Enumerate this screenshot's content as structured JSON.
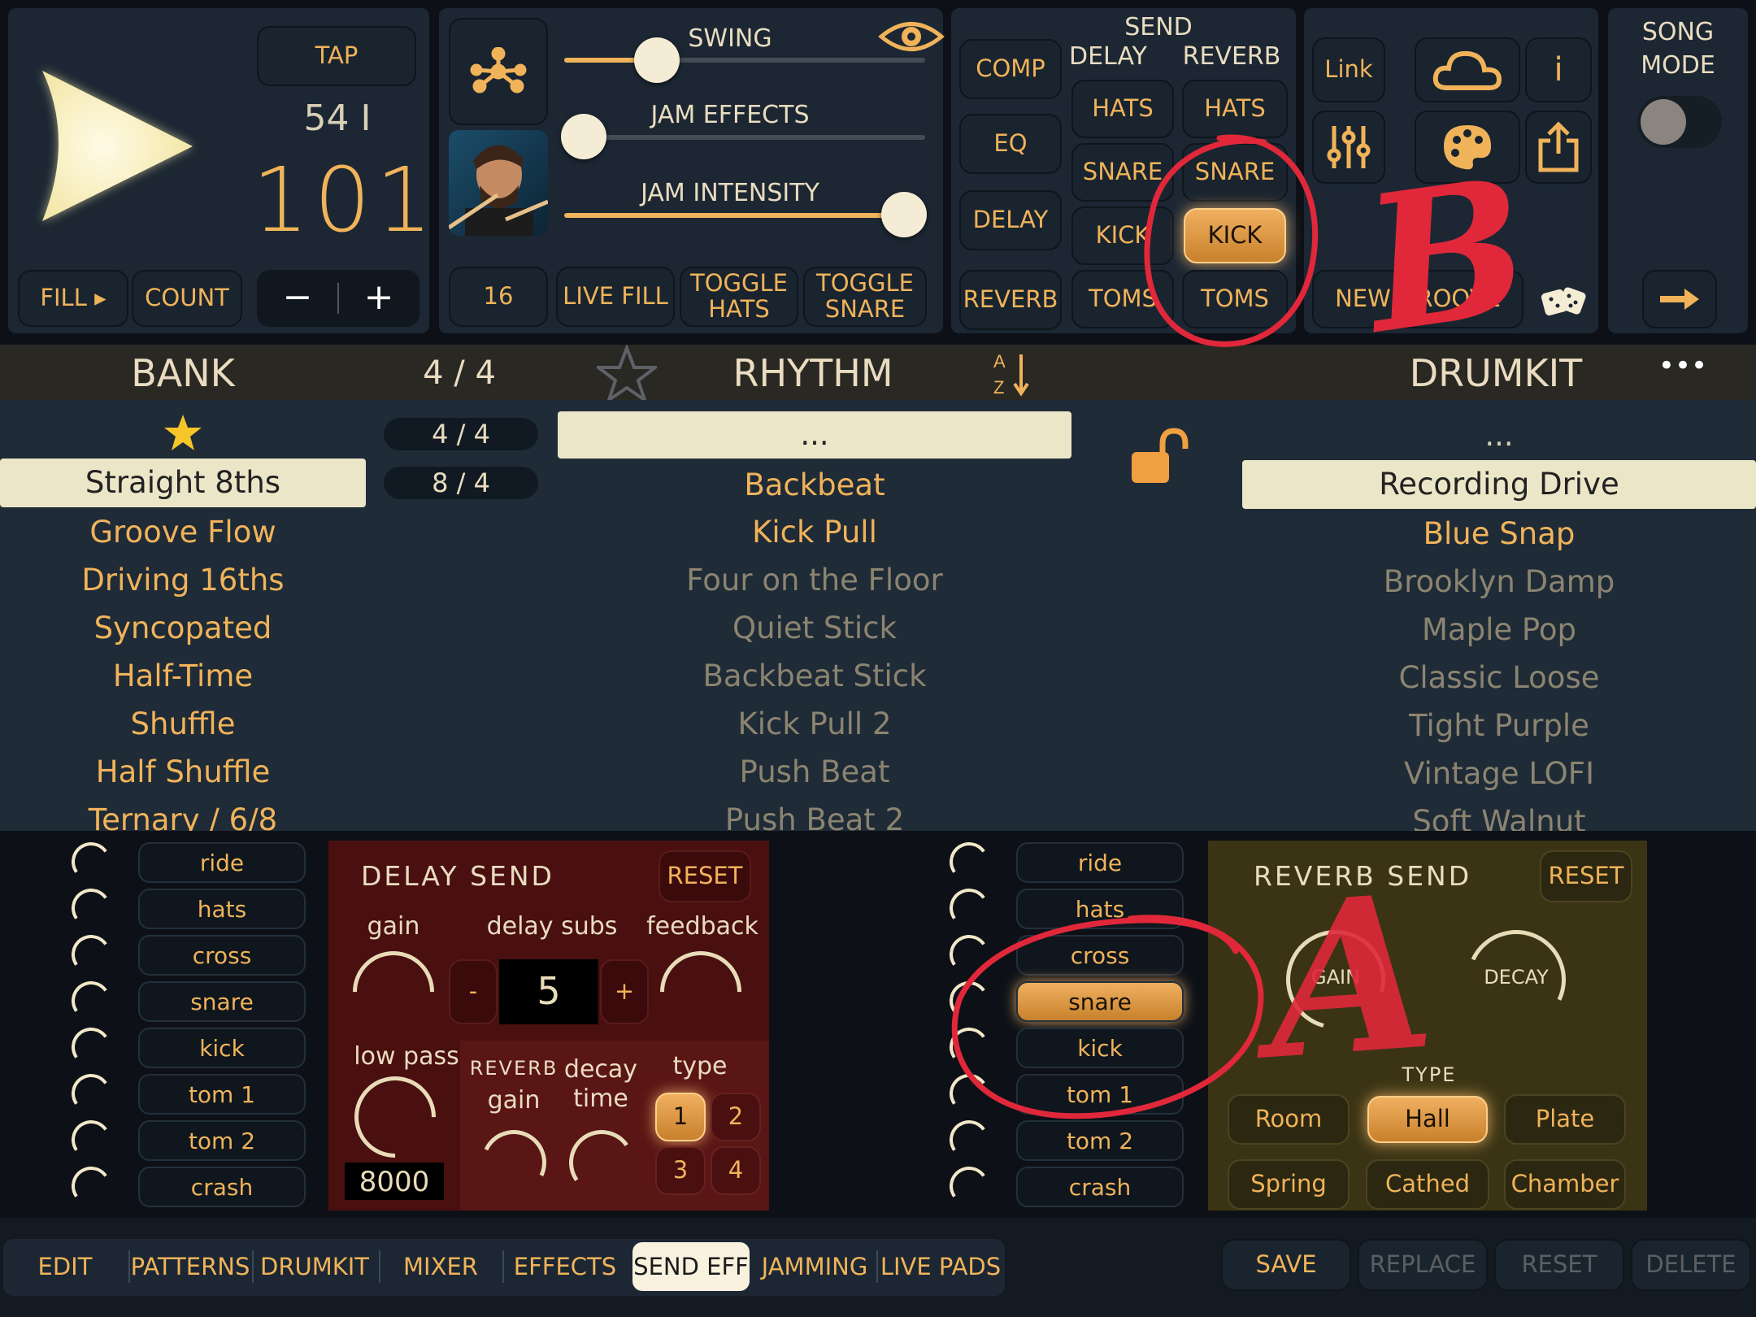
{
  "transport": {
    "tap": "TAP",
    "bar": "54 I",
    "tempo": "101",
    "fill": "FILL ▸",
    "count": "COUNT",
    "minus": "−",
    "plus": "+"
  },
  "jam": {
    "swing": "SWING",
    "jam_effects": "JAM EFFECTS",
    "jam_intensity": "JAM INTENSITY",
    "swing_level": 0.15,
    "effects_level": 0.0,
    "intensity_level": 1.0,
    "steps": "16",
    "live_fill": "LIVE FILL",
    "toggle_hats": "TOGGLE HATS",
    "toggle_snare": "TOGGLE SNARE"
  },
  "send": {
    "title": "SEND",
    "delay": "DELAY",
    "reverb": "REVERB",
    "comp": "COMP",
    "eq": "EQ",
    "delay_btn": "DELAY",
    "reverb_btn": "REVERB",
    "delay_col": [
      "HATS",
      "SNARE",
      "KICK",
      "TOMS"
    ],
    "reverb_col": [
      "HATS",
      "SNARE",
      "KICK",
      "TOMS"
    ],
    "reverb_active": "KICK"
  },
  "util": {
    "link": "Link",
    "info": "i",
    "new_groove": "NEW GROOVE"
  },
  "song": {
    "label": "SONG MODE"
  },
  "header": {
    "bank": "BANK",
    "sig": "4 / 4",
    "rhythm": "RHYTHM",
    "drumkit": "DRUMKIT",
    "more": "•••"
  },
  "bank_list": [
    "Straight 8ths",
    "Groove Flow",
    "Driving 16ths",
    "Syncopated",
    "Half-Time",
    "Shuffle",
    "Half Shuffle",
    "Ternary / 6/8"
  ],
  "sig_list": [
    "4 / 4",
    "8 / 4"
  ],
  "rhythm_list": [
    "...",
    "Backbeat",
    "Kick Pull",
    "Four on the Floor",
    "Quiet Stick",
    "Backbeat Stick",
    "Kick Pull 2",
    "Push Beat",
    "Push Beat 2"
  ],
  "drumkit_list": [
    "...",
    "Recording Drive",
    "Blue Snap",
    "Brooklyn Damp",
    "Maple Pop",
    "Classic Loose",
    "Tight Purple",
    "Vintage LOFI",
    "Soft Walnut"
  ],
  "channels": [
    "ride",
    "hats",
    "cross",
    "snare",
    "kick",
    "tom 1",
    "tom 2",
    "crash"
  ],
  "delay_send": {
    "title": "DELAY SEND",
    "reset": "RESET",
    "gain": "gain",
    "delay_subs": "delay subs",
    "feedback": "feedback",
    "subs_value": "5",
    "minus": "-",
    "plus": "+",
    "low_pass": "low pass",
    "low_pass_value": "8000",
    "reverb": "REVERB",
    "reverb_gain": "gain",
    "decay_time": "decay time",
    "type": "type",
    "types": [
      "1",
      "2",
      "3",
      "4"
    ]
  },
  "reverb_send": {
    "title": "REVERB SEND",
    "reset": "RESET",
    "gain": "GAIN",
    "decay": "DECAY",
    "type": "TYPE",
    "types": [
      "Room",
      "Hall",
      "Plate",
      "Spring",
      "Cathed",
      "Chamber"
    ],
    "active_type": "Hall",
    "active_channel": "snare"
  },
  "tabs": [
    "EDIT",
    "PATTERNS",
    "DRUMKIT",
    "MIXER",
    "EFFECTS",
    "SEND EFF",
    "JAMMING",
    "LIVE PADS"
  ],
  "active_tab": "SEND EFF",
  "actions": [
    "SAVE",
    "REPLACE",
    "RESET",
    "DELETE"
  ],
  "annotations": {
    "a": "A",
    "b": "B"
  },
  "colors": {
    "accent": "#f0b35a",
    "annotation": "#e0283a",
    "panel": "#1c2733"
  }
}
